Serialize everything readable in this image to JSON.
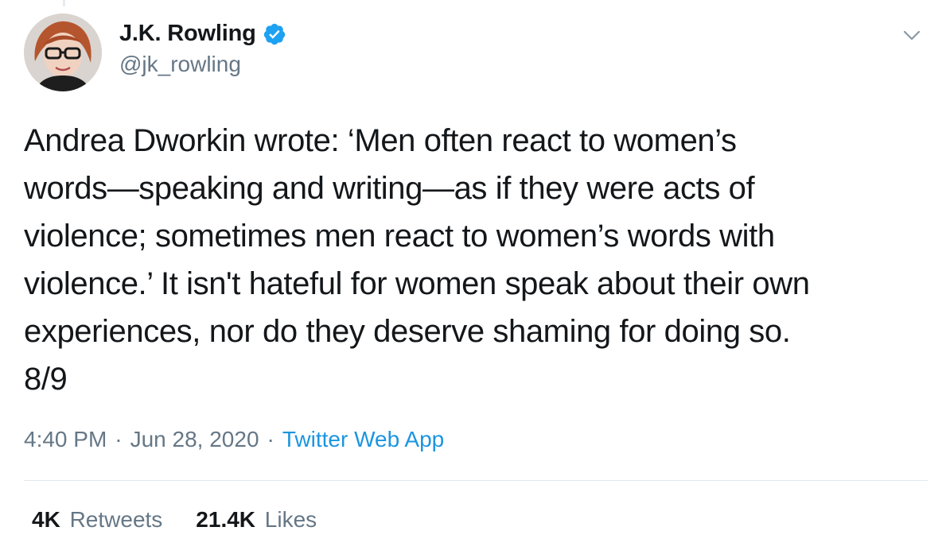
{
  "author": {
    "display_name": "J.K. Rowling",
    "handle": "@jk_rowling",
    "verified": true
  },
  "tweet": {
    "text": "Andrea Dworkin wrote: ‘Men often react to women’s\nwords—speaking and writing—as if they were acts of\nviolence; sometimes men react to women’s words with\nviolence.’ It isn't hateful for women speak about their own\nexperiences, nor do they deserve shaming for doing so.\n8/9",
    "time": "4:40 PM",
    "date": "Jun 28, 2020",
    "source": "Twitter Web App",
    "separator": "·"
  },
  "stats": {
    "retweets_count": "4K",
    "retweets_label": "Retweets",
    "likes_count": "21.4K",
    "likes_label": "Likes"
  },
  "colors": {
    "link_blue": "#1b95e0",
    "verified_blue": "#1da1f2",
    "secondary_text": "#657786",
    "primary_text": "#14171a"
  },
  "icons": {
    "verified": "verified-badge-icon",
    "menu": "chevron-down-icon"
  }
}
